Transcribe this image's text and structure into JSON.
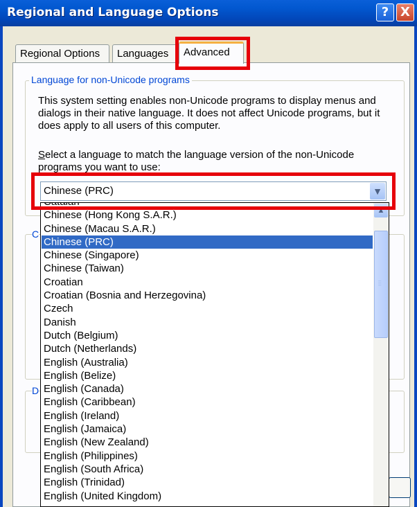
{
  "window": {
    "title": "Regional and Language Options",
    "help_label": "?",
    "close_label": "X"
  },
  "tabs": [
    {
      "label": "Regional Options"
    },
    {
      "label": "Languages"
    },
    {
      "label": "Advanced"
    }
  ],
  "group": {
    "title": "Language for non-Unicode programs",
    "description": "This system setting enables non-Unicode programs to display menus and dialogs in their native language. It does not affect Unicode programs, but it does apply to all users of this computer.",
    "prompt_rest": "elect a language to match the language version of the non-Unicode programs you want to use:",
    "prompt_accel": "S"
  },
  "other_groups": {
    "g2_letter": "C",
    "g3_letter": "D"
  },
  "combo": {
    "value": "Chinese (PRC)",
    "arrow_icon": "chevron-down-icon"
  },
  "dropdown": {
    "options": [
      "Catalan",
      "Chinese (Hong Kong S.A.R.)",
      "Chinese (Macau S.A.R.)",
      "Chinese (PRC)",
      "Chinese (Singapore)",
      "Chinese (Taiwan)",
      "Croatian",
      "Croatian (Bosnia and Herzegovina)",
      "Czech",
      "Danish",
      "Dutch (Belgium)",
      "Dutch (Netherlands)",
      "English (Australia)",
      "English (Belize)",
      "English (Canada)",
      "English (Caribbean)",
      "English (Ireland)",
      "English (Jamaica)",
      "English (New Zealand)",
      "English (Philippines)",
      "English (South Africa)",
      "English (Trinidad)",
      "English (United Kingdom)"
    ],
    "selected_index": 3
  },
  "colors": {
    "highlight": "#e6000a",
    "selection": "#316ac5",
    "group_title": "#0046d5"
  }
}
